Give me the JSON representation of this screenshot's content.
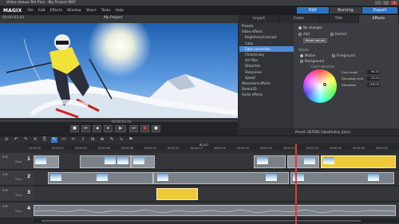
{
  "titlebar": {
    "title": "Video deluxe MX Plus - My Project.MEP"
  },
  "menubar": {
    "logo": "MAGIX",
    "items": [
      "File",
      "Edit",
      "Effects",
      "Window",
      "Share",
      "Tasks",
      "Help"
    ],
    "modes": {
      "edit": "Edit",
      "burning": "Burning",
      "export": "Export"
    }
  },
  "preview": {
    "timecode": "00:00:03:01",
    "title": "My Project"
  },
  "transport": {
    "timecode": "00:00:01:01",
    "buttons": [
      "■",
      "⏮",
      "◀",
      "⏹",
      "▶",
      "⏭",
      "●",
      "■"
    ]
  },
  "effects": {
    "tabs": [
      "Import",
      "Fades",
      "Title",
      "Effects"
    ],
    "list": [
      {
        "label": "Presets",
        "sub": false
      },
      {
        "label": "Video effects",
        "sub": false
      },
      {
        "label": "Brightness/Contrast",
        "sub": true
      },
      {
        "label": "Color",
        "sub": true
      },
      {
        "label": "Color correction",
        "sub": true,
        "selected": true
      },
      {
        "label": "Chroma key",
        "sub": true
      },
      {
        "label": "Art filter",
        "sub": true
      },
      {
        "label": "Distortion",
        "sub": true
      },
      {
        "label": "Sharpness",
        "sub": true
      },
      {
        "label": "Speed",
        "sub": true
      },
      {
        "label": "Movement effects",
        "sub": false
      },
      {
        "label": "Stereo3D",
        "sub": false
      },
      {
        "label": "Audio effects",
        "sub": false
      }
    ],
    "no_changes": "No changes",
    "add_label": "Add",
    "extract_label": "Extract",
    "reset_label": "Reset values",
    "shade": "Shade",
    "master": "Master",
    "foreground": "Foreground",
    "background": "Background",
    "color_selection": "Color selection",
    "fields": [
      {
        "label": "Color angle",
        "value": "94.32"
      },
      {
        "label": "Saturation limit",
        "value": "22.24"
      },
      {
        "label": "Saturation",
        "value": "128.00"
      }
    ],
    "mini_label": "Preset: DEFERE Substitution_Extra"
  },
  "toolbar": {
    "icons": [
      "⎌",
      "↶",
      "↷",
      "✕",
      "⎘",
      "↖",
      "▭",
      "✂",
      "♪",
      "⇆",
      "⊕",
      "✎",
      "∿",
      "⚑"
    ]
  },
  "timeline": {
    "project_label": "BLAST",
    "ruler_marks": [
      "00:00:00",
      "00:00:02",
      "00:00:04",
      "00:00:06",
      "00:00:08",
      "00:00:10",
      "00:00:12",
      "00:00:14",
      "00:00:16",
      "00:00:18",
      "00:00:20",
      "00:00:22",
      "00:00:24",
      "00:00:26",
      "00:00:28",
      "00:00:30"
    ],
    "tracks": [
      {
        "num": "1",
        "label": "S M",
        "sub": "Track"
      },
      {
        "num": "2",
        "label": "S M",
        "sub": "Track"
      },
      {
        "num": "3",
        "label": "S M",
        "sub": "Track"
      },
      {
        "num": "4",
        "label": "S M",
        "sub": "Track"
      }
    ]
  },
  "colors": {
    "accent": "#2e73c2",
    "clip_yellow": "#f0c93a",
    "playhead": "#e23b2f",
    "selection": "#4d8ad6"
  }
}
